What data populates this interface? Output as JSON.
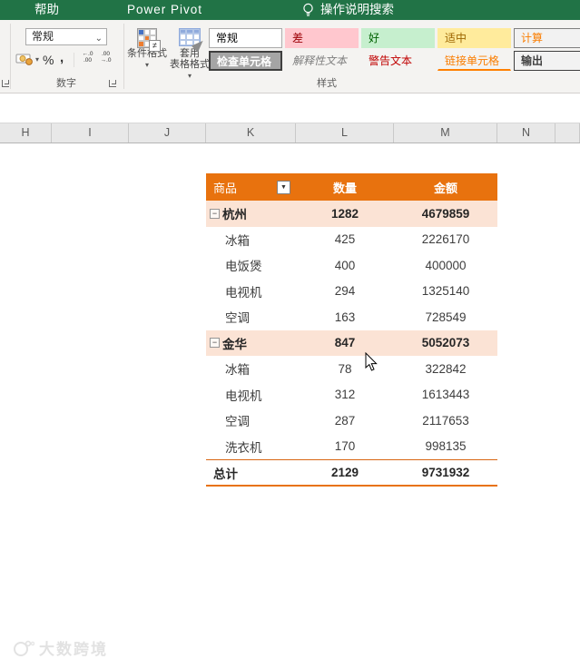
{
  "titlebar": {
    "tabs": [
      {
        "label": "帮助"
      },
      {
        "label": "Power Pivot"
      }
    ],
    "search_label": "操作说明搜索"
  },
  "ribbon": {
    "number_group": {
      "format_value": "常规",
      "percent_label": "%",
      "comma_label": ",",
      "inc_decimal_top": "←.0",
      "inc_decimal_bottom": ".00",
      "dec_decimal_top": ".00",
      "dec_decimal_bottom": "→.0",
      "group_label": "数字"
    },
    "styles_group": {
      "conditional_label": "条件格式",
      "format_table_line1": "套用",
      "format_table_line2": "表格格式",
      "neq_glyph": "≠",
      "group_label": "样式",
      "gallery": [
        {
          "label": "常规",
          "bg": "#FFFFFF",
          "color": "#000000",
          "border": "#ABABAB"
        },
        {
          "label": "差",
          "bg": "#FFC7CE",
          "color": "#9C0006"
        },
        {
          "label": "好",
          "bg": "#C6EFCE",
          "color": "#006100"
        },
        {
          "label": "适中",
          "bg": "#FFEB9C",
          "color": "#9C6500"
        },
        {
          "label": "计算",
          "bg": "#F2F2F2",
          "color": "#FA7D00",
          "border": "#7F7F7F"
        },
        {
          "label": "检查单元格",
          "bg": "#A5A5A5",
          "color": "#FFFFFF",
          "border": "#3F3F3F",
          "bold": true,
          "thick": true
        },
        {
          "label": "解释性文本",
          "color": "#7F7F7F",
          "italic": true
        },
        {
          "label": "警告文本",
          "color": "#C00000"
        },
        {
          "label": "链接单元格",
          "color": "#FA7D00",
          "underline": "#FF8001"
        },
        {
          "label": "输出",
          "bg": "#F2F2F2",
          "color": "#3F3F3F",
          "border": "#3F3F3F",
          "bold": true
        }
      ]
    }
  },
  "icons": {
    "dropdown_chevron": "⌄",
    "small_dropdown": "▾",
    "filter_arrow": "▼",
    "collapse_glyph": "−"
  },
  "sheet": {
    "columns": [
      "H",
      "I",
      "J",
      "K",
      "L",
      "M",
      "N"
    ]
  },
  "pivot": {
    "headers": {
      "product": "商品",
      "qty": "数量",
      "amount": "金额"
    },
    "rows": [
      {
        "type": "group",
        "label": "杭州",
        "qty": "1282",
        "amount": "4679859"
      },
      {
        "type": "detail",
        "label": "冰箱",
        "qty": "425",
        "amount": "2226170"
      },
      {
        "type": "detail",
        "label": "电饭煲",
        "qty": "400",
        "amount": "400000"
      },
      {
        "type": "detail",
        "label": "电视机",
        "qty": "294",
        "amount": "1325140"
      },
      {
        "type": "detail",
        "label": "空调",
        "qty": "163",
        "amount": "728549"
      },
      {
        "type": "group",
        "label": "金华",
        "qty": "847",
        "amount": "5052073"
      },
      {
        "type": "detail",
        "label": "冰箱",
        "qty": "78",
        "amount": "322842"
      },
      {
        "type": "detail",
        "label": "电视机",
        "qty": "312",
        "amount": "1613443"
      },
      {
        "type": "detail",
        "label": "空调",
        "qty": "287",
        "amount": "2117653"
      },
      {
        "type": "detail",
        "label": "洗衣机",
        "qty": "170",
        "amount": "998135"
      }
    ],
    "total": {
      "label": "总计",
      "qty": "2129",
      "amount": "9731932"
    }
  },
  "watermark": {
    "text": "大数跨境"
  },
  "colors": {
    "excel_green": "#217346",
    "pivot_header_orange": "#E8720E",
    "pivot_group_fill": "#FBE3D5",
    "total_border_orange": "#D86613"
  }
}
